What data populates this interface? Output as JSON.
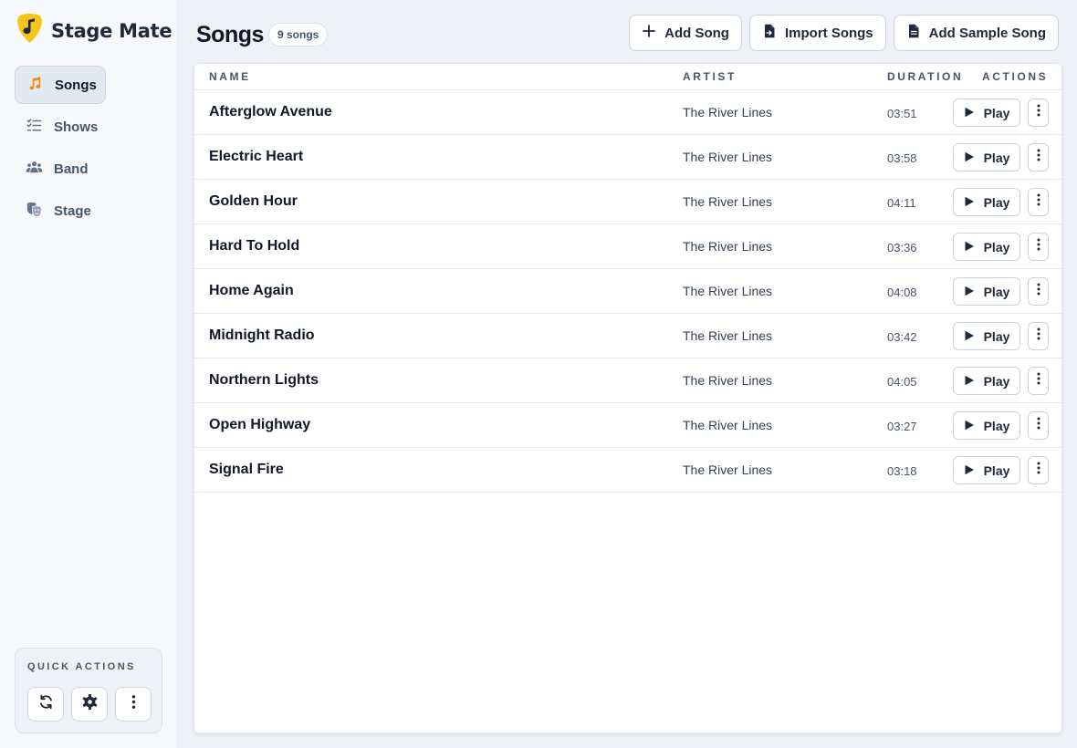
{
  "app": {
    "name": "Stage Mate",
    "logo_icon": "guitar-pick-music-note-icon",
    "accent_color": "#f5c518",
    "active_icon_color": "#f28c18"
  },
  "sidebar": {
    "items": [
      {
        "label": "Songs",
        "icon": "music-note-icon",
        "active": true
      },
      {
        "label": "Shows",
        "icon": "checklist-icon",
        "active": false
      },
      {
        "label": "Band",
        "icon": "users-icon",
        "active": false
      },
      {
        "label": "Stage",
        "icon": "masks-icon",
        "active": false
      }
    ],
    "quick_actions": {
      "title": "QUICK ACTIONS",
      "buttons": [
        "refresh-icon",
        "gear-icon",
        "more-vertical-icon"
      ]
    }
  },
  "header": {
    "title": "Songs",
    "count_badge": "9 songs",
    "buttons": {
      "add_song": "Add Song",
      "import_songs": "Import Songs",
      "add_sample_song": "Add Sample Song"
    }
  },
  "table": {
    "columns": {
      "name": "NAME",
      "artist": "ARTIST",
      "duration": "DURATION",
      "actions": "ACTIONS"
    },
    "play_label": "Play",
    "rows": [
      {
        "name": "Afterglow Avenue",
        "artist": "The River Lines",
        "duration": "03:51"
      },
      {
        "name": "Electric Heart",
        "artist": "The River Lines",
        "duration": "03:58"
      },
      {
        "name": "Golden Hour",
        "artist": "The River Lines",
        "duration": "04:11"
      },
      {
        "name": "Hard To Hold",
        "artist": "The River Lines",
        "duration": "03:36"
      },
      {
        "name": "Home Again",
        "artist": "The River Lines",
        "duration": "04:08"
      },
      {
        "name": "Midnight Radio",
        "artist": "The River Lines",
        "duration": "03:42"
      },
      {
        "name": "Northern Lights",
        "artist": "The River Lines",
        "duration": "04:05"
      },
      {
        "name": "Open Highway",
        "artist": "The River Lines",
        "duration": "03:27"
      },
      {
        "name": "Signal Fire",
        "artist": "The River Lines",
        "duration": "03:18"
      }
    ]
  }
}
